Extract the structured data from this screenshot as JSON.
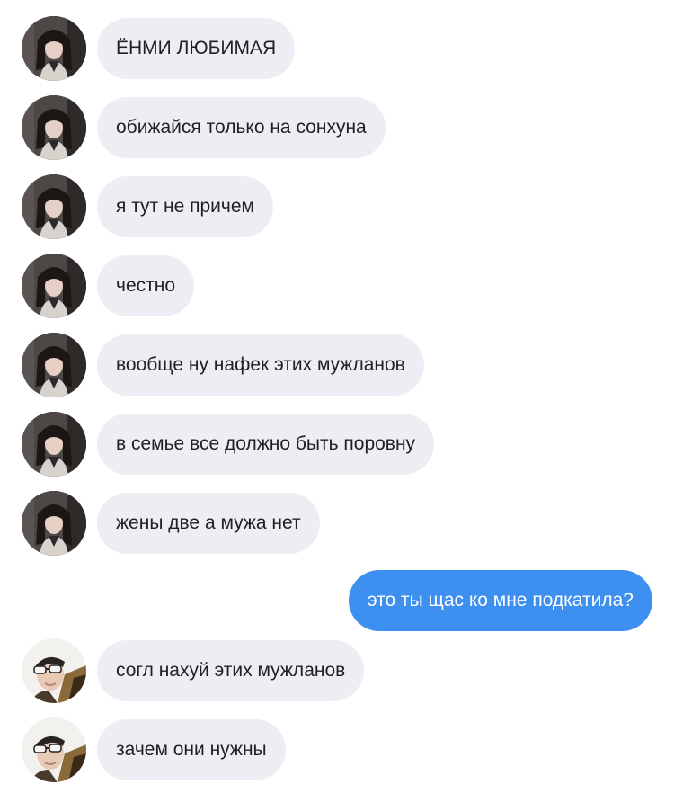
{
  "conversation": {
    "messages": [
      {
        "text": "ЁНМИ ЛЮБИМАЯ",
        "direction": "incoming",
        "avatar": "avatar-girl-dark-hair-icon"
      },
      {
        "text": "обижайся только на сонхуна",
        "direction": "incoming",
        "avatar": "avatar-girl-dark-hair-icon"
      },
      {
        "text": "я тут не причем",
        "direction": "incoming",
        "avatar": "avatar-girl-dark-hair-icon"
      },
      {
        "text": "честно",
        "direction": "incoming",
        "avatar": "avatar-girl-dark-hair-icon"
      },
      {
        "text": "вообще ну нафек этих мужланов",
        "direction": "incoming",
        "avatar": "avatar-girl-dark-hair-icon"
      },
      {
        "text": "в семье все должно быть поровну",
        "direction": "incoming",
        "avatar": "avatar-girl-dark-hair-icon"
      },
      {
        "text": "жены две а мужа нет",
        "direction": "incoming",
        "avatar": "avatar-girl-dark-hair-icon"
      },
      {
        "text": "это ты щас ко мне подкатила?",
        "direction": "outgoing"
      },
      {
        "text": "согл нахуй этих мужланов",
        "direction": "incoming",
        "avatar": "avatar-guy-sunglasses-icon"
      },
      {
        "text": "зачем они нужны",
        "direction": "incoming",
        "avatar": "avatar-guy-sunglasses-icon"
      }
    ]
  },
  "colors": {
    "incoming_bubble": "#eceef3",
    "incoming_text": "#1f2024",
    "outgoing_bubble": "#3d8ff0",
    "outgoing_text": "#ffffff"
  }
}
